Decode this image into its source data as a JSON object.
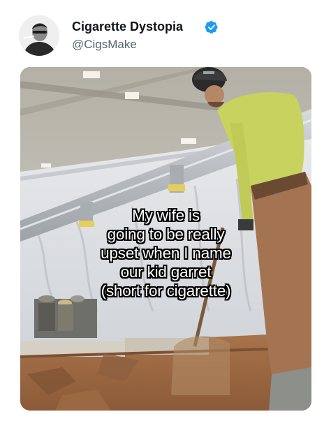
{
  "tweet": {
    "display_name": "Cigarette Dystopia",
    "handle": "@CigsMake",
    "verified": true,
    "verified_color": "#1d9bf0"
  },
  "media": {
    "caption_lines": [
      "My wife is",
      "going to be really",
      "upset when I name",
      "our kid garret",
      "(short for cigarette)"
    ]
  },
  "icons": {
    "verified": "verified-badge-icon",
    "avatar": "profile-photo"
  }
}
